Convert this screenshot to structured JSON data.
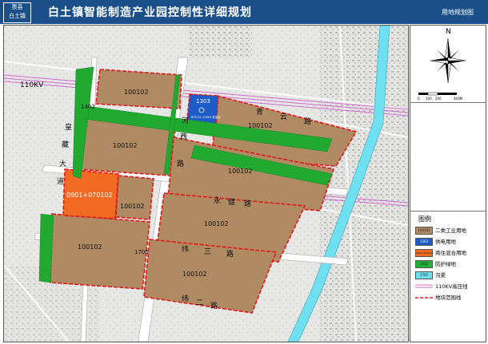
{
  "header": {
    "badge_line1": "票县",
    "badge_line2": "白土镇",
    "title": "白土镇智能制造产业园控制性详细规划",
    "subtitle": "用地规划图"
  },
  "map": {
    "powerline_label": "110KV",
    "roads": [
      "青",
      "云",
      "路",
      "河",
      "西",
      "路",
      "皇",
      "藏",
      "大",
      "道",
      "永",
      "健",
      "路",
      "纬",
      "三",
      "路",
      "纬",
      "二",
      "路"
    ],
    "parcels": [
      "100102",
      "100102",
      "100102",
      "100102",
      "100102",
      "100102",
      "100102",
      "100102",
      "0901+070102"
    ],
    "small_labels": [
      "1303",
      "1402",
      "1705"
    ],
    "substation_text": "BTZ-01 110KV 变电站"
  },
  "north": {
    "letter": "N"
  },
  "scale": {
    "ticks": [
      "0",
      "100",
      "200",
      "400M"
    ]
  },
  "legend": {
    "title": "图例",
    "items": [
      {
        "code": "100102",
        "label": "二类工业用地",
        "color": "#b08a62"
      },
      {
        "code": "1303",
        "label": "供电用地",
        "color": "#1e5bc8"
      },
      {
        "code": "0901+070102",
        "label": "商住混合用地",
        "color": "#f06a21"
      },
      {
        "code": "1402",
        "label": "防护绿地",
        "color": "#22b032"
      },
      {
        "code": "1705",
        "label": "沟渠",
        "color": "#6fe0f0"
      },
      {
        "code": "",
        "label": "110KV高压线",
        "color": "#d26ad2"
      },
      {
        "code": "",
        "label": "地块范围线",
        "color": "#e01a1a"
      }
    ]
  }
}
